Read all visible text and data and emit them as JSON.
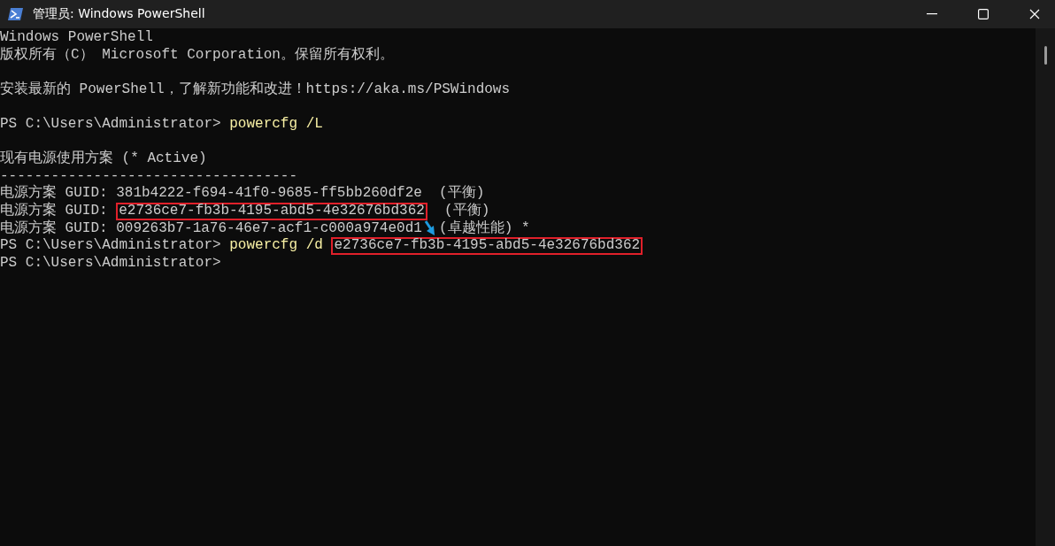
{
  "window": {
    "title": "管理员: Windows PowerShell"
  },
  "console": {
    "lines": [
      {
        "kind": "text",
        "segments": [
          {
            "kind": "text",
            "text": "Windows PowerShell"
          }
        ]
      },
      {
        "kind": "text",
        "segments": [
          {
            "kind": "text",
            "text": "版权所有（C） Microsoft Corporation。保留所有权利。"
          }
        ]
      },
      {
        "kind": "blank"
      },
      {
        "kind": "text",
        "segments": [
          {
            "kind": "text",
            "text": "安装最新的 PowerShell，了解新功能和改进！https://aka.ms/PSWindows"
          }
        ]
      },
      {
        "kind": "blank"
      },
      {
        "kind": "text",
        "segments": [
          {
            "kind": "text",
            "text": "PS C:\\Users\\Administrator> "
          },
          {
            "kind": "command",
            "text": "powercfg /L"
          }
        ]
      },
      {
        "kind": "blank"
      },
      {
        "kind": "text",
        "segments": [
          {
            "kind": "text",
            "text": "现有电源使用方案 (* Active)"
          }
        ]
      },
      {
        "kind": "text",
        "segments": [
          {
            "kind": "text",
            "text": "-----------------------------------"
          }
        ]
      },
      {
        "kind": "text",
        "segments": [
          {
            "kind": "text",
            "text": "电源方案 GUID: 381b4222-f694-41f0-9685-ff5bb260df2e  (平衡)"
          }
        ]
      },
      {
        "kind": "text",
        "segments": [
          {
            "kind": "text",
            "text": "电源方案 GUID: "
          },
          {
            "kind": "highlight",
            "text": "e2736ce7-fb3b-4195-abd5-4e32676bd362"
          },
          {
            "kind": "text",
            "text": "  (平衡)"
          }
        ]
      },
      {
        "kind": "text",
        "segments": [
          {
            "kind": "text",
            "text": "电源方案 GUID: 009263b7-1a76-46e7-acf1-c000a974e0d1"
          },
          {
            "kind": "arrow"
          },
          {
            "kind": "text",
            "text": "(卓越性能) *"
          }
        ]
      },
      {
        "kind": "text",
        "segments": [
          {
            "kind": "text",
            "text": "PS C:\\Users\\Administrator> "
          },
          {
            "kind": "command",
            "text": "powercfg /d "
          },
          {
            "kind": "highlight",
            "text": "e2736ce7-fb3b-4195-abd5-4e32676bd362"
          }
        ]
      },
      {
        "kind": "text",
        "segments": [
          {
            "kind": "text",
            "text": "PS C:\\Users\\Administrator>"
          }
        ]
      }
    ]
  }
}
